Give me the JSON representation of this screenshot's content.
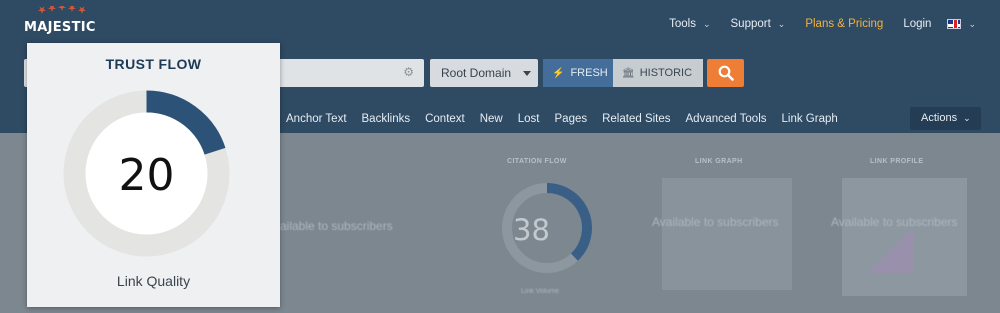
{
  "logo": {
    "text": "MAJESTIC"
  },
  "topnav": {
    "tools": "Tools",
    "support": "Support",
    "pricing": "Plans & Pricing",
    "login": "Login"
  },
  "search": {
    "scope": "Root Domain",
    "fresh": "FRESH",
    "historic": "HISTORIC"
  },
  "subnav": [
    "Anchor Text",
    "Backlinks",
    "Context",
    "New",
    "Lost",
    "Pages",
    "Related Sites",
    "Advanced Tools",
    "Link Graph"
  ],
  "actions": "Actions",
  "background": {
    "citation_flow_title": "CITATION FLOW",
    "citation_flow_value": "38",
    "citation_flow_sub": "Link Volume",
    "link_graph_title": "LINK GRAPH",
    "link_graph_text": "Available to subscribers",
    "link_profile_title": "LINK PROFILE",
    "link_profile_text": "Available to subscribers",
    "left_text": "ailable to subscribers"
  },
  "trust_flow": {
    "title": "TRUST FLOW",
    "value": "20",
    "label": "Link Quality",
    "fraction": 0.2,
    "color": "#2d5277",
    "track_color": "#e4e4e2"
  }
}
